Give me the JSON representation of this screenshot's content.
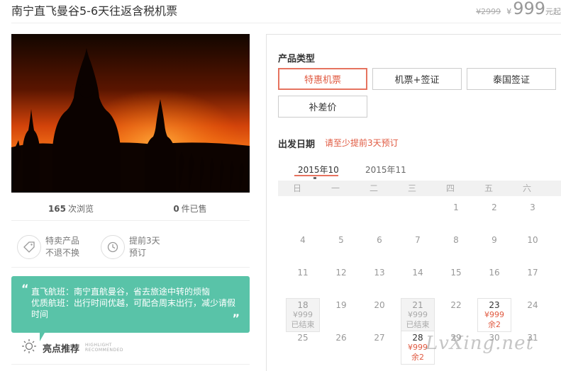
{
  "header": {
    "title": "南宁直飞曼谷5-6天往返含税机票",
    "old_price": "¥2999",
    "currency": "¥",
    "price": "999",
    "unit": "元起"
  },
  "stats": {
    "views": "165",
    "views_label": "次浏览",
    "sold": "0",
    "sold_label": "件已售"
  },
  "features": [
    {
      "icon": "tag-icon",
      "line1": "特卖产品",
      "line2": "不退不换"
    },
    {
      "icon": "clock-icon",
      "line1": "提前3天",
      "line2": "预订"
    }
  ],
  "note": {
    "line1": "直飞航班：南宁直航曼谷，省去旅途中转的烦恼",
    "line2": "优质航班：出行时间优越，可配合周末出行，减少请假时间",
    "open_quote": "“",
    "close_quote": "”"
  },
  "highlight": {
    "label": "亮点推荐",
    "en1": "HIGHLIGHT",
    "en2": "RECOMMENDED"
  },
  "panel": {
    "product_type_title": "产品类型",
    "product_types": [
      "特惠机票",
      "机票+签证",
      "泰国签证",
      "补差价"
    ],
    "selected_type": "特惠机票",
    "date_title": "出发日期",
    "date_hint": "请至少提前3天预订",
    "months": [
      "2015年10",
      "2015年11"
    ],
    "weekdays": [
      "日",
      "一",
      "二",
      "三",
      "四",
      "五",
      "六"
    ],
    "days": [
      {
        "d": "1"
      },
      {
        "d": "2"
      },
      {
        "d": "3"
      },
      {
        "d": "4"
      },
      {
        "d": "5"
      },
      {
        "d": "6"
      },
      {
        "d": "7"
      },
      {
        "d": "8"
      },
      {
        "d": "9"
      },
      {
        "d": "10"
      },
      {
        "d": "11"
      },
      {
        "d": "12"
      },
      {
        "d": "13"
      },
      {
        "d": "14"
      },
      {
        "d": "15"
      },
      {
        "d": "16"
      },
      {
        "d": "17"
      },
      {
        "d": "18",
        "price": "¥999",
        "status": "已结束"
      },
      {
        "d": "19"
      },
      {
        "d": "20"
      },
      {
        "d": "21",
        "price": "¥999",
        "status": "已结束"
      },
      {
        "d": "22"
      },
      {
        "d": "23",
        "price": "¥999",
        "status": "余2"
      },
      {
        "d": "24"
      },
      {
        "d": "25"
      },
      {
        "d": "26"
      },
      {
        "d": "27"
      },
      {
        "d": "28",
        "price": "¥999",
        "status": "余2"
      },
      {
        "d": "29"
      },
      {
        "d": "30"
      },
      {
        "d": "31"
      }
    ]
  },
  "watermark": "LvXing.net",
  "colors": {
    "accent": "#e05a41",
    "note_bg": "#59c3a8",
    "muted": "#999999"
  }
}
